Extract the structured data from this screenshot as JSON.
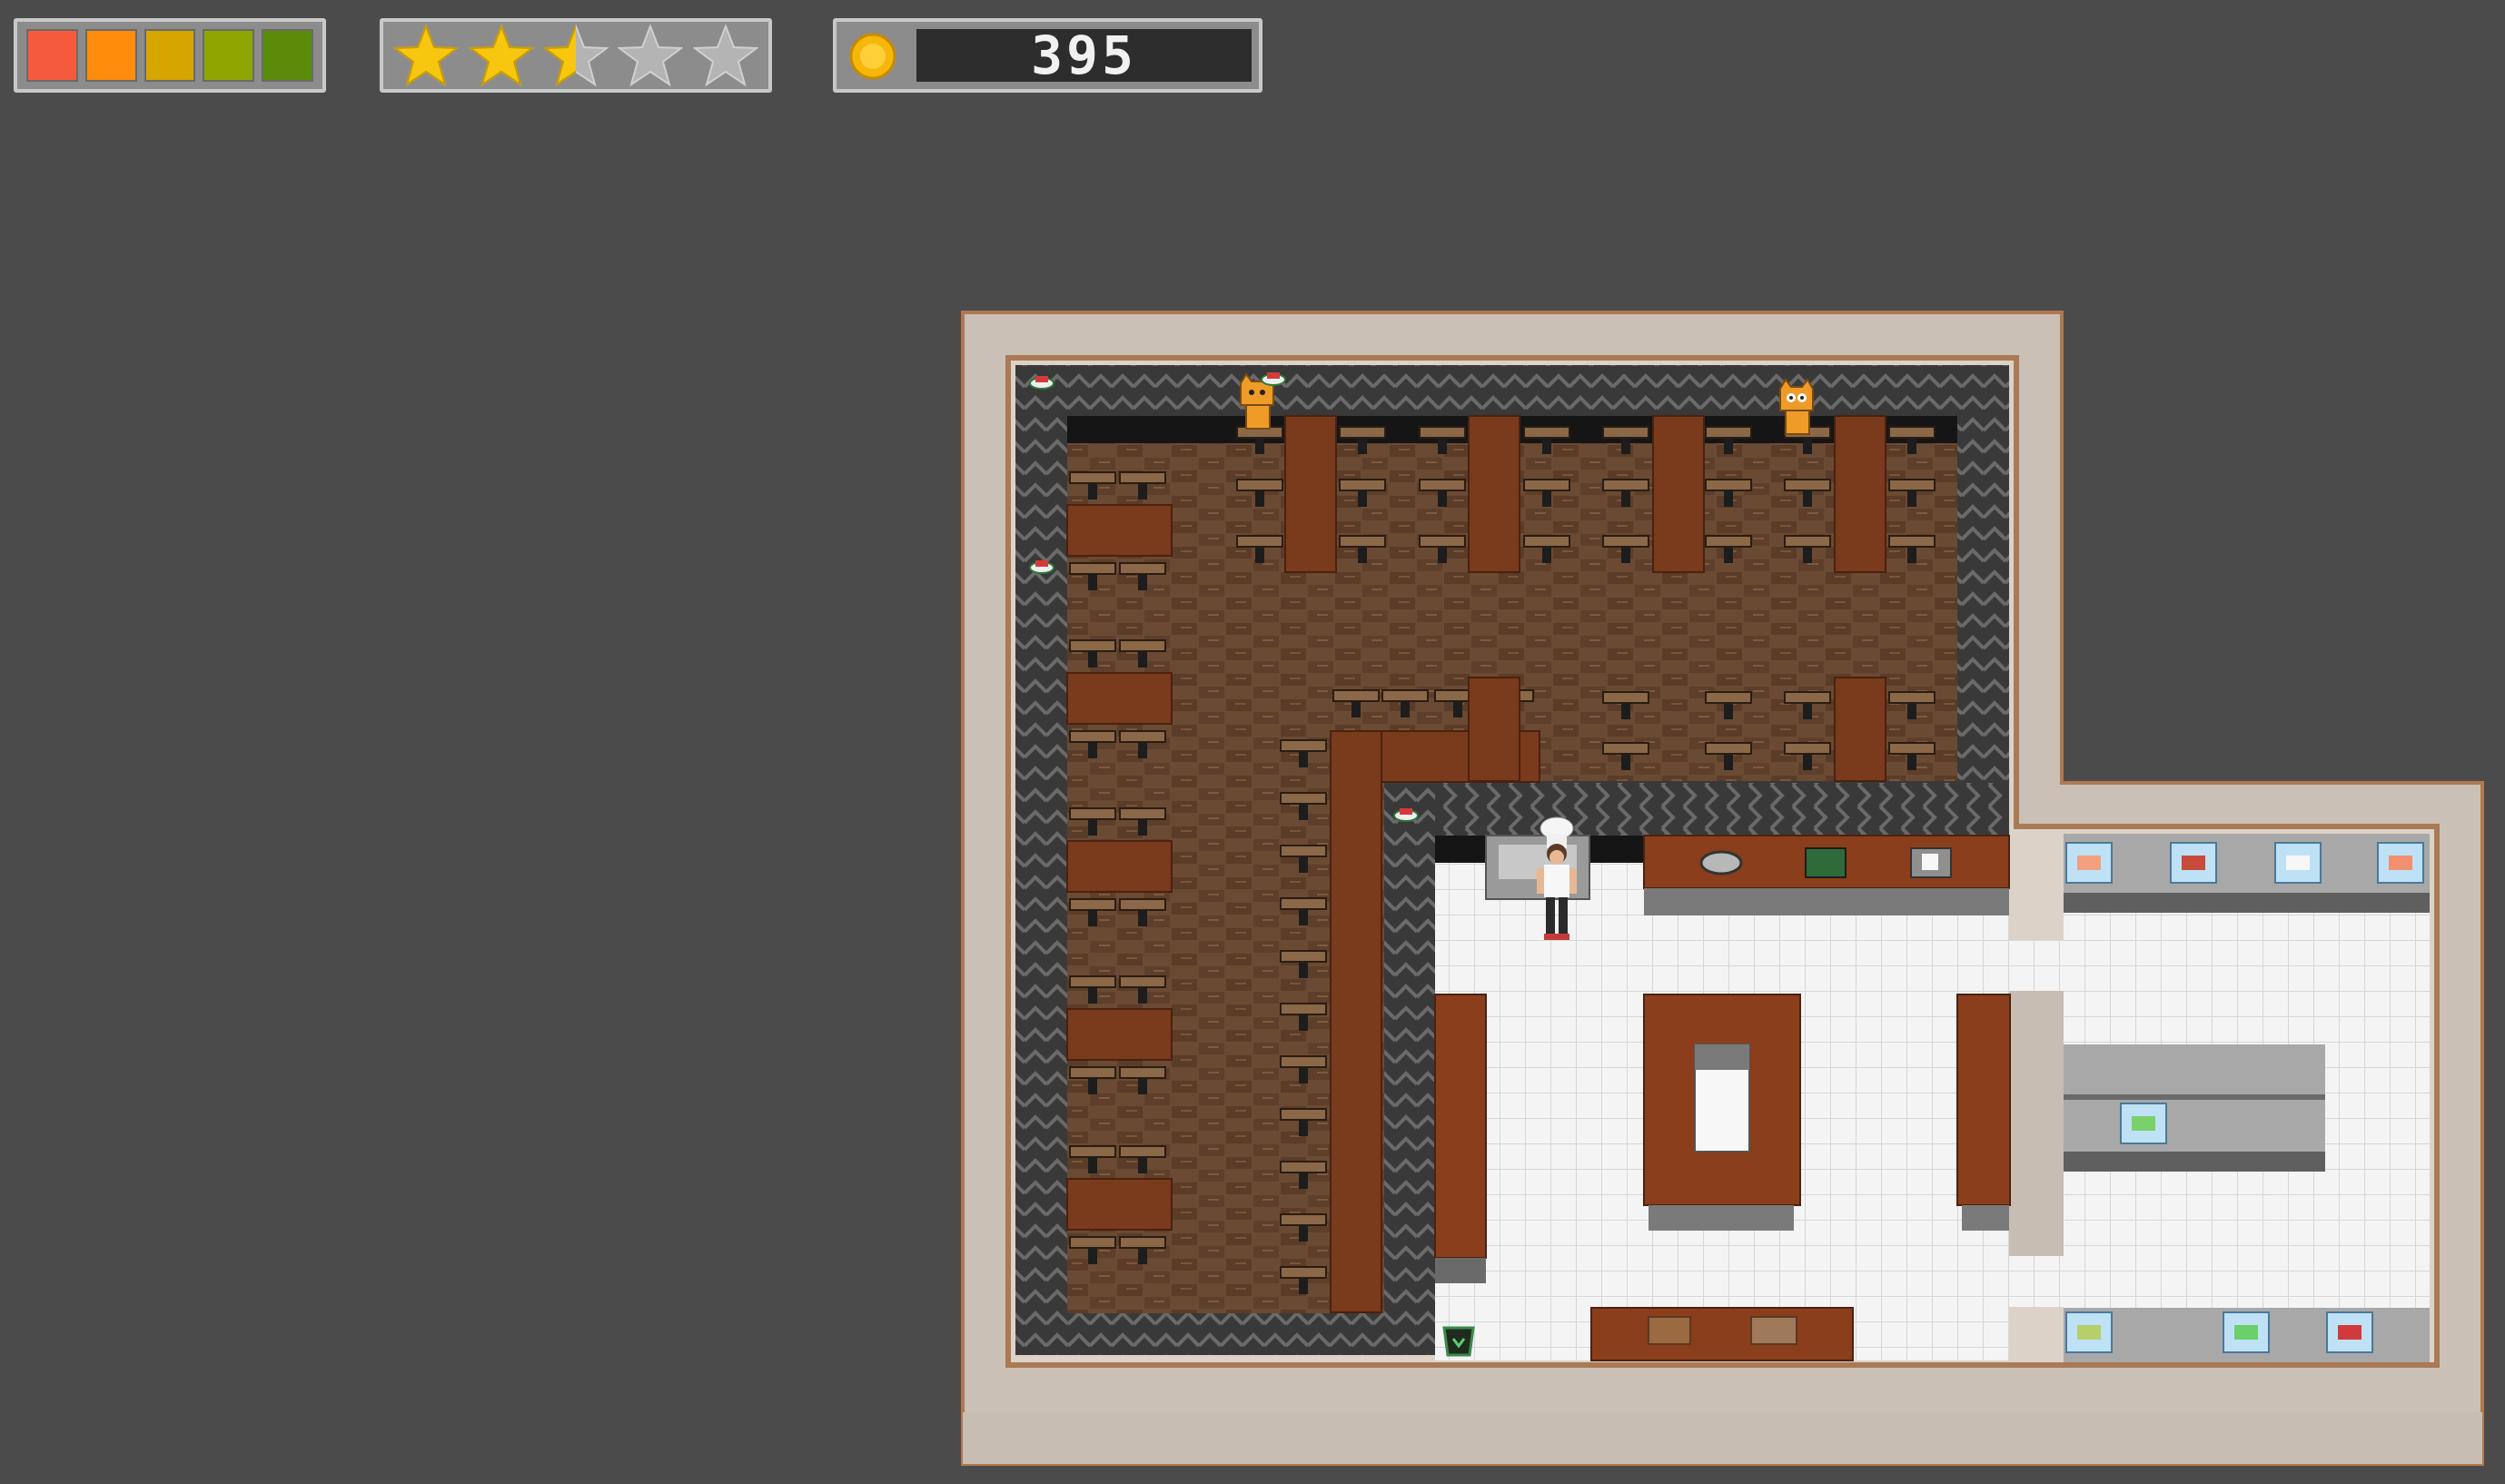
{
  "hud": {
    "health": {
      "segments": [
        "#f55a3c",
        "#ff8c0a",
        "#d7a500",
        "#8fa600",
        "#5a8c0a"
      ],
      "filled": 5,
      "total": 5
    },
    "rating": {
      "stars_filled": 2.5,
      "stars_total": 5,
      "star_color": "#f7c70f",
      "empty_color": "#b4b4b4"
    },
    "coins": {
      "icon": "coin-icon",
      "value": "395",
      "coin_color": "#f5b80a"
    }
  },
  "scene": {
    "areas": [
      "dining-room",
      "kitchen",
      "pantry"
    ],
    "characters": [
      {
        "name": "chef",
        "role": "player"
      },
      {
        "name": "cat-customer",
        "count": 2
      }
    ],
    "kitchen_appliances": [
      "pot",
      "cutting-board",
      "rice-cooker",
      "sink",
      "trash-bin",
      "bamboo-mat",
      "knife"
    ],
    "pantry_ingredients": [
      "salmon",
      "tuna",
      "rice",
      "shrimp",
      "cucumber",
      "avocado",
      "tomato",
      "seaweed"
    ]
  }
}
